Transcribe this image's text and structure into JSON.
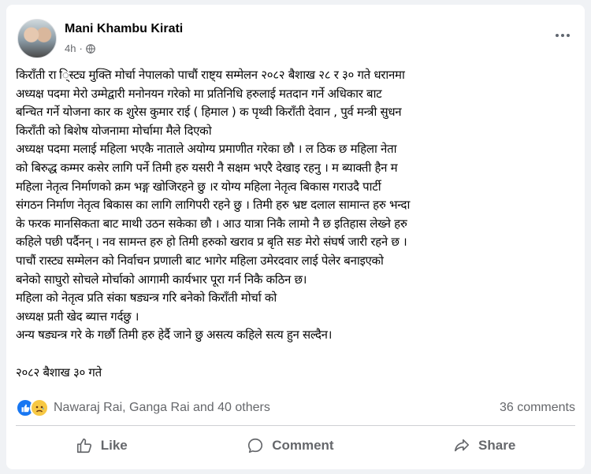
{
  "post": {
    "author": "Mani Khambu Kirati",
    "time": "4h",
    "separator": "·",
    "body_lines": [
      "किराँती  रा ि्स्ट्य  मुक्ति मोर्चा नेपालको पाचौं  राष्ट्य सम्मेलन २०८२ बैशाख २८ र ३० गते  धरानमा",
      "अध्यक्ष पदमा मेरो  उम्मेद्वारी मनोनयन  गरेको मा    प्रतिनिधि  हरुलाई  मतदान गर्ने अधिकार बाट",
      "बन्चित गर्ने योजना कार क शुरेस कुमार राई  ( हिमाल )  क पृथ्वी  किराँती देवान ,  पुर्व मन्त्री सुधन",
      "किराँती को बिशेष योजनामा  मोर्चामा मैले दिएको",
      "अध्यक्ष पदमा मलाई महिला भएकै नाताले  अयोग्य प्रमाणीत गरेका छौ ।    ल ठिक  छ   महिला नेता",
      "को  बिरुद्ध कम्मर कसेर लागि पर्ने  तिमी हरु यसरी नै सक्षम भएरै देखाइ रहनु । म ब्याक्ती हैन  म",
      "महिला नेतृत्व निर्माणको क्रम भङ्ग  खोजिरहने छु  ।र योग्य  महिला नेतृत्व बिकास गराउदै   पार्टी",
      "संगठन  निर्माण नेतृत्व बिकास का  लागि लागिपरी रहने छु । तिमी हरु भ्रष्ट  दलाल सामान्त  हरु भन्दा",
      "के  फरक मानसिकता बाट माथी उठन सकेका छौ  ।  आउ यात्रा  निकै लामो नै छ  इतिहास  लेख्ने हरु",
      "कहिले पछी पर्दैनन्   । नव सामन्त  हरु हो  तिमी हरुको खराव प्र बृति सङ मेरो  संघर्ष जारी रहने छ ।",
      "पाचौं रास्ट्य सम्मेलन को   निर्वाचन प्रणाली बाट भागेर  महिला उमेरदवार लाई पेलेर बनाइएको",
      "बनेको  साघुरो सोचले मोर्चाको  आगामी कार्यभार  पूरा गर्न निकै कठिन छ।",
      "महिला को नेतृत्व प्रति संका षड्यन्त्र गरि बनेको किराँती मोर्चा को",
      "   अध्यक्ष प्रती खेद ब्यात्त  गर्दछु ।",
      "अन्य षड्यन्त्र गरे  के गर्छौ  तिमी हरु हेर्दै जाने छु असत्य कहिले सत्य हुन सल्दैन।",
      "",
      "२०८२ बैशाख ३० गते"
    ]
  },
  "reactions": {
    "names": "Nawaraj Rai, Ganga Rai and 40 others",
    "comments": "36 comments",
    "icons": [
      "like-icon",
      "sad-icon"
    ]
  },
  "actions": {
    "like": "Like",
    "comment": "Comment",
    "share": "Share"
  },
  "colors": {
    "like_blue": "#1877f2",
    "sad_yellow": "#f7c844",
    "muted": "#65676b"
  }
}
